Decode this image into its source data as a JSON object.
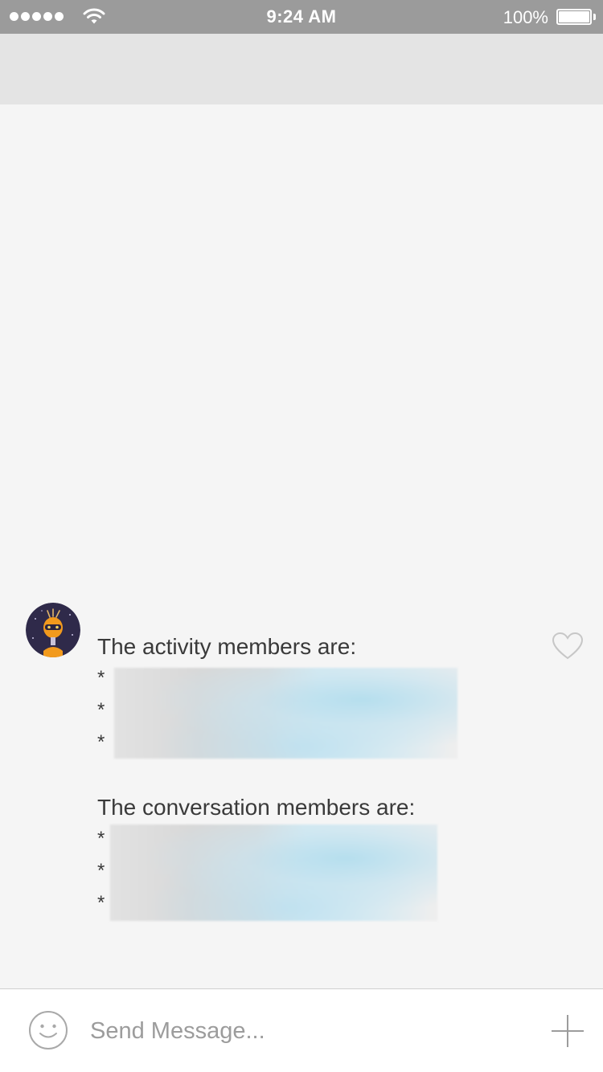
{
  "status_bar": {
    "time": "9:24 AM",
    "battery_percent": "100%",
    "signal_bars": 5
  },
  "conversation": {
    "message": {
      "activity_heading": "The activity members are:",
      "activity_members": [
        "*",
        "*",
        "*"
      ],
      "conversation_heading": "The conversation members are:",
      "conversation_members": [
        "*",
        "*",
        "*"
      ],
      "liked": false
    }
  },
  "composer": {
    "placeholder": "Send Message...",
    "emoji_icon": "smiley-icon",
    "add_icon": "plus-icon"
  },
  "colors": {
    "status_bar_bg": "#9b9b9b",
    "nav_bar_bg": "#e4e4e4",
    "chat_bg": "#f5f5f5",
    "avatar_bg": "#2f2a4a",
    "avatar_accent": "#f29a1d"
  }
}
